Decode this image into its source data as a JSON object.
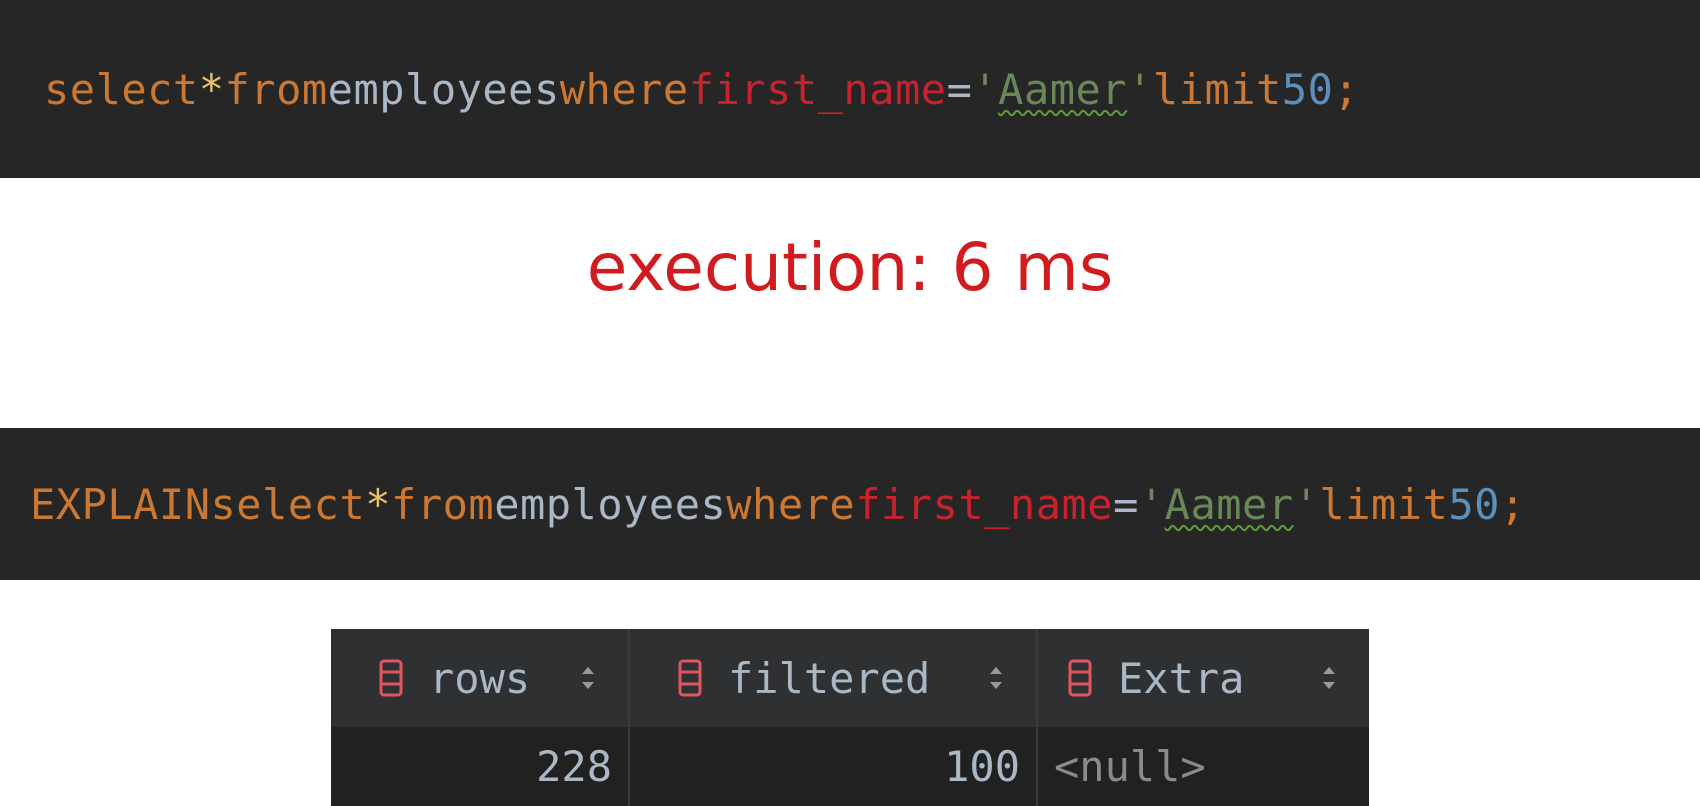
{
  "query1": {
    "select": "select",
    "star": "*",
    "from": "from",
    "table": "employees",
    "where": "where",
    "column": "first_name",
    "eq": "=",
    "quote_open": "'",
    "value": "Aamer",
    "quote_close": "'",
    "limit": "limit",
    "limit_value": "50",
    "semicolon": ";"
  },
  "execution_label": "execution: 6 ms",
  "query2": {
    "explain": "EXPLAIN",
    "select": "select",
    "star": "*",
    "from": "from",
    "table": "employees",
    "where": "where",
    "column": "first_name",
    "eq": "=",
    "quote_open": "'",
    "value": "Aamer",
    "quote_close": "'",
    "limit": "limit",
    "limit_value": "50",
    "semicolon": ";"
  },
  "result_grid": {
    "columns": [
      {
        "label": "rows",
        "icon": "column-icon"
      },
      {
        "label": "filtered",
        "icon": "column-icon"
      },
      {
        "label": "Extra",
        "icon": "column-icon"
      }
    ],
    "rows": [
      [
        "228",
        "100",
        "<null>"
      ]
    ]
  },
  "colors": {
    "keyword": "#cc7832",
    "column_name": "#c7222d",
    "number": "#5d8fbd",
    "string": "#6a8759",
    "execution_text": "#d01c1f",
    "column_icon": "#e05561"
  }
}
